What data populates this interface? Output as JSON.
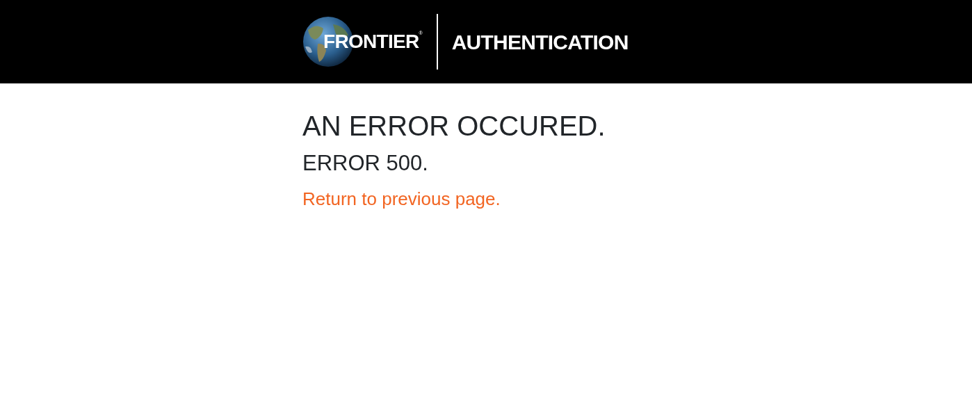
{
  "header": {
    "logo_text": "FRONTIER",
    "logo_mark": "®",
    "title": "AUTHENTICATION"
  },
  "content": {
    "heading": "AN ERROR OCCURED.",
    "subheading": "ERROR 500.",
    "link": "Return to previous page."
  }
}
